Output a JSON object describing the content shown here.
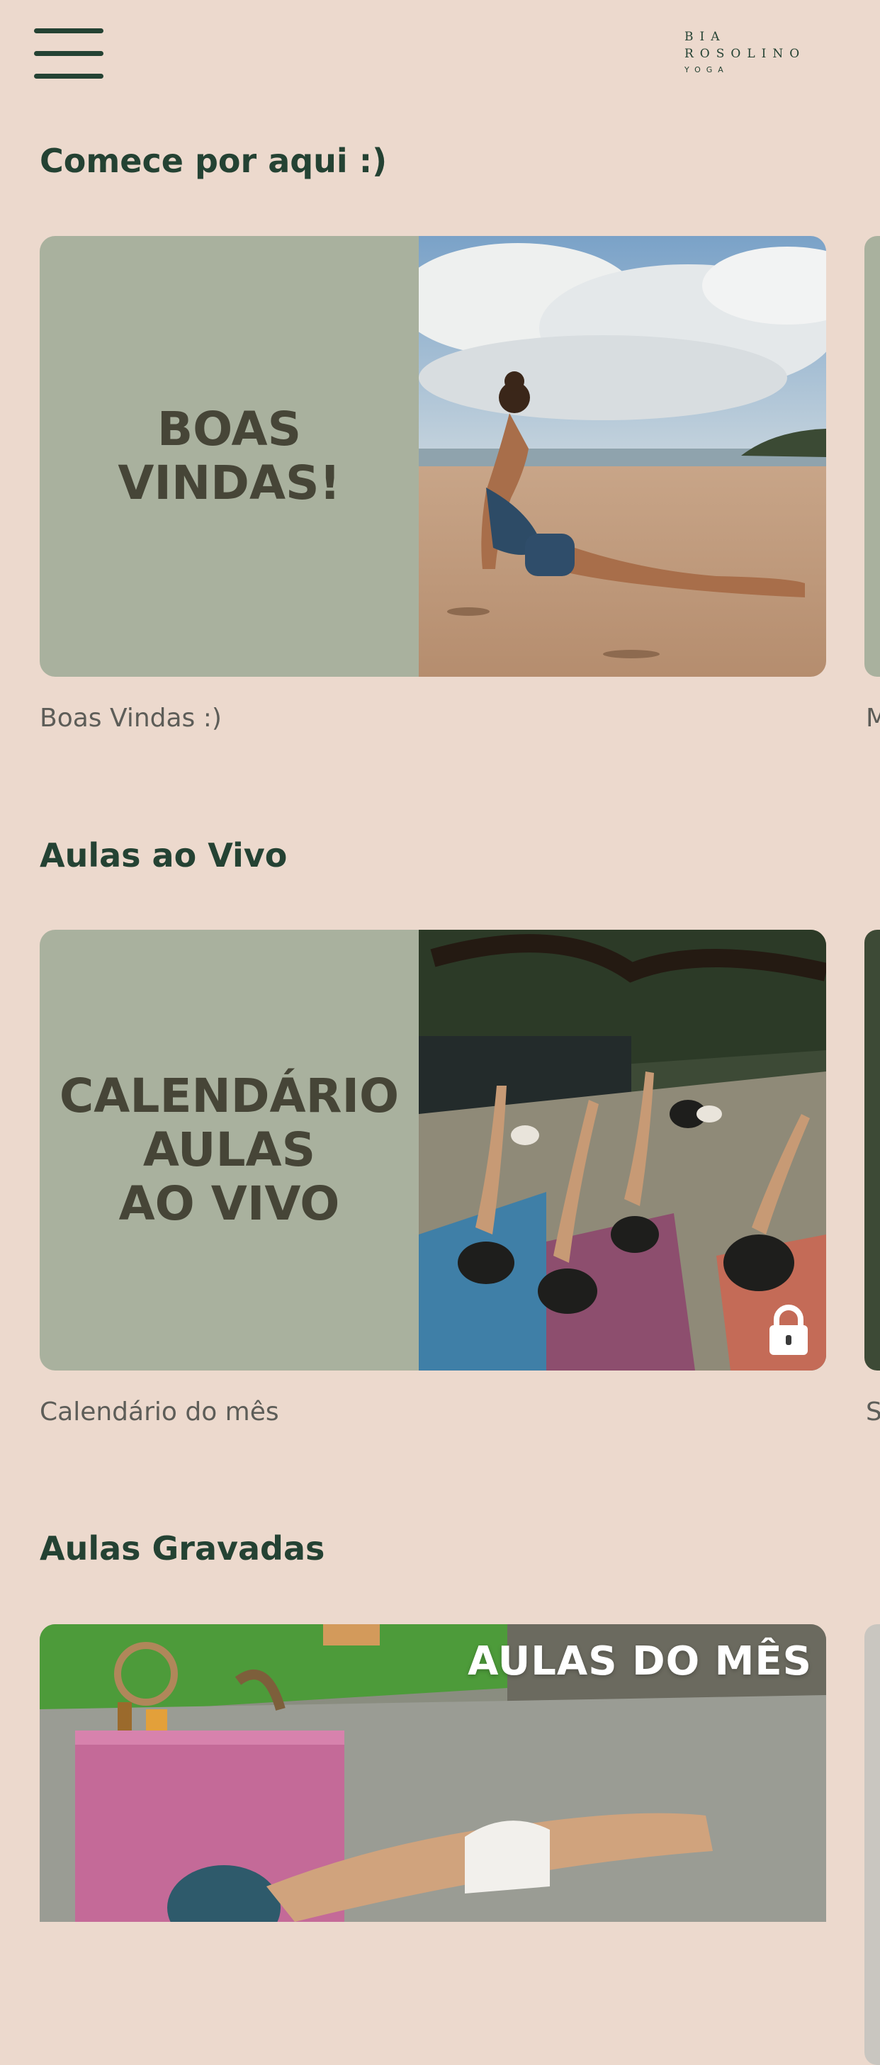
{
  "header": {
    "logo_line1": "BIA",
    "logo_line2": "ROSOLINO",
    "logo_line3": "YOGA"
  },
  "sections": [
    {
      "title": "Comece por aqui :)",
      "card": {
        "title": "BOAS\nVINDAS!",
        "label": "Boas Vindas :)",
        "image": "yoga-beach-photo"
      },
      "next_label": "M"
    },
    {
      "title": "Aulas ao Vivo",
      "card": {
        "title": "CALENDÁRIO\nAULAS\nAO VIVO",
        "label": "Calendário do mês",
        "image": "yoga-group-class-photo",
        "locked": true
      },
      "next_label": "S"
    },
    {
      "title": "Aulas Gravadas",
      "card": {
        "banner": "AULAS DO MÊS",
        "image": "yoga-outdoor-photo"
      }
    }
  ],
  "icons": {
    "menu": "hamburger-menu-icon",
    "lock": "lock-icon"
  },
  "colors": {
    "background": "#ecd9cd",
    "card_green": "#a9b19e",
    "heading": "#244233",
    "card_text": "#464537"
  }
}
